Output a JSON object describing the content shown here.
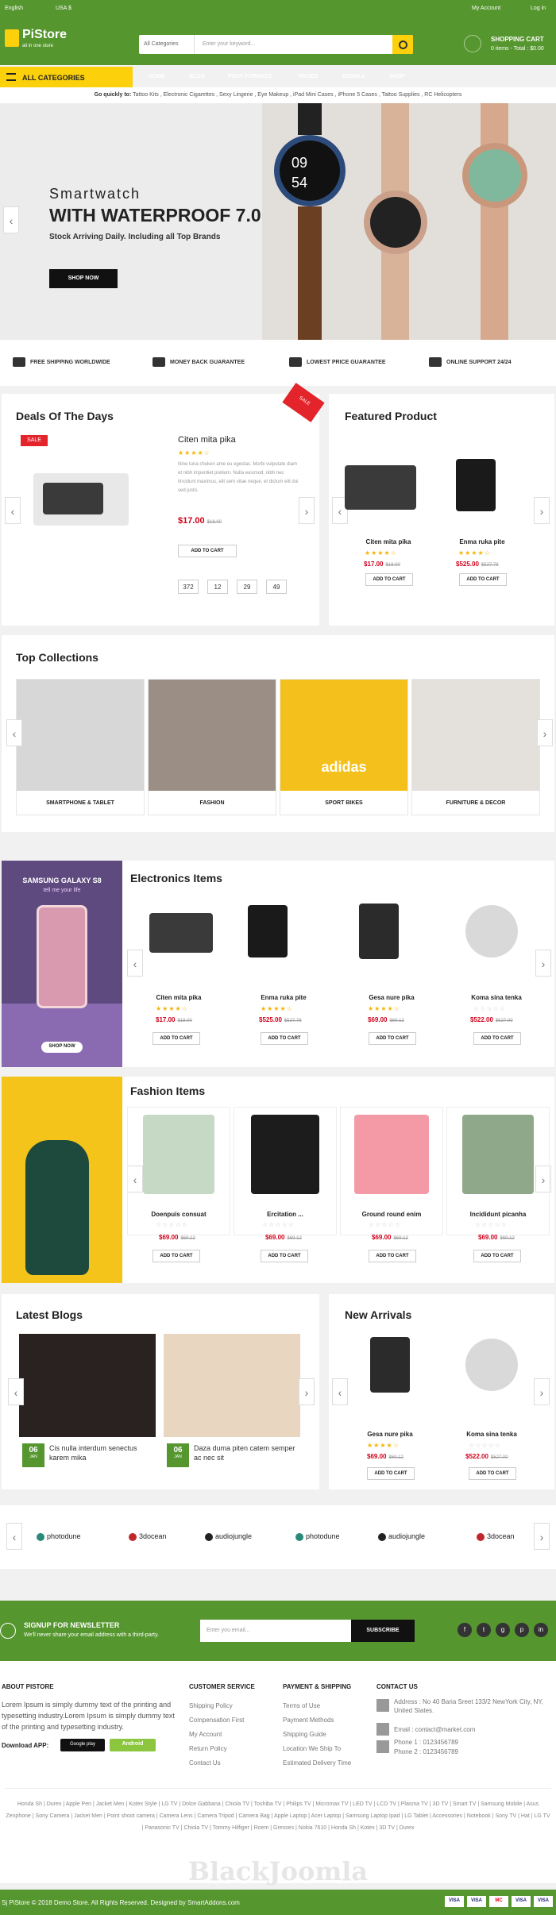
{
  "topbar": {
    "language": "English",
    "currency": "USA $",
    "account": "My Account",
    "login": "Log in"
  },
  "header": {
    "logo": "PiStore",
    "tagline": "all in one store",
    "search_category": "All Categories",
    "search_placeholder": "Enter your keyword...",
    "cart_title": "SHOPPING CART",
    "cart_summary": "0 items - Total : $0.00"
  },
  "nav": {
    "all_categories": "ALL CATEGORIES",
    "items": [
      "HOME",
      "BLOG",
      "POST FORMATS",
      "PAGES",
      "JOOMLA",
      "SHOP"
    ]
  },
  "quick": {
    "label": "Go quickly to:",
    "links": "Tattoo Kits , Electronic Cigarettes , Sexy Lingerie , Eye Makeup , iPad Mini Cases , iPhone 5 Cases , Tattoo Supplies , RC Helicopters"
  },
  "hero": {
    "line1": "Smartwatch",
    "line2": "WITH WATERPROOF 7.0",
    "line3": "Stock Arriving Daily. Including all Top Brands",
    "button": "SHOP NOW",
    "watch_time_h": "09",
    "watch_time_m": "54"
  },
  "services": [
    "FREE SHIPPING WORLDWIDE",
    "MONEY BACK GUARANTEE",
    "LOWEST PRICE GUARANTEE",
    "ONLINE SUPPORT 24/24"
  ],
  "deals": {
    "title": "Deals Of The Days",
    "sale_badge": "SALE",
    "name": "Citen mita pika",
    "stars": "★★★★☆",
    "desc": "Nine tuna chuken ame eu egestas. Morbi vulputate diam et nibh imperdiet pretium. Nulla euismod, nibh nec tincidunt maximus, elit sem vitae neque, et dictum elit dui sed justo.",
    "price": "$17.00",
    "old_price": "$18.00",
    "button": "ADD TO CART",
    "countdown": [
      "372",
      "12",
      "29",
      "49"
    ],
    "ribbon": "SALE"
  },
  "featured": {
    "title": "Featured Product",
    "items": [
      {
        "name": "Citen mita pika",
        "stars": "★★★★☆",
        "price": "$17.00",
        "old": "$18.00",
        "button": "ADD TO CART"
      },
      {
        "name": "Enma ruka pite",
        "stars": "★★★★☆",
        "price": "$525.00",
        "old": "$527.78",
        "button": "ADD TO CART"
      }
    ]
  },
  "collections": {
    "title": "Top Collections",
    "items": [
      "SMARTPHONE & TABLET",
      "FASHION",
      "SPORT BIKES",
      "FURNITURE & DECOR"
    ],
    "jacket_text": "adidas"
  },
  "electronics": {
    "title": "Electronics Items",
    "banner_line1": "SAMSUNG GALAXY S8",
    "banner_line2": "tell me your life",
    "banner_button": "SHOP NOW",
    "items": [
      {
        "name": "Citen mita pika",
        "stars": "★★★★☆",
        "price": "$17.00",
        "old": "$18.00",
        "button": "ADD TO CART"
      },
      {
        "name": "Enma ruka pite",
        "stars": "★★★★☆",
        "price": "$525.00",
        "old": "$527.78",
        "button": "ADD TO CART"
      },
      {
        "name": "Gesa nure pika",
        "stars": "★★★★☆",
        "price": "$69.00",
        "old": "$69.12",
        "button": "ADD TO CART"
      },
      {
        "name": "Koma sina tenka",
        "stars": "☆☆☆☆☆",
        "price": "$522.00",
        "old": "$527.00",
        "button": "ADD TO CART"
      }
    ]
  },
  "fashion": {
    "title": "Fashion Items",
    "items": [
      {
        "name": "Doenpuis consuat",
        "stars": "☆☆☆☆☆",
        "price": "$69.00",
        "old": "$69.12",
        "button": "ADD TO CART"
      },
      {
        "name": "Ercitation ...",
        "stars": "☆☆☆☆☆",
        "price": "$69.00",
        "old": "$69.12",
        "button": "ADD TO CART"
      },
      {
        "name": "Ground round enim",
        "stars": "☆☆☆☆☆",
        "price": "$69.00",
        "old": "$69.12",
        "button": "ADD TO CART"
      },
      {
        "name": "Incididunt picanha",
        "stars": "☆☆☆☆☆",
        "price": "$69.00",
        "old": "$69.12",
        "button": "ADD TO CART"
      }
    ]
  },
  "blogs": {
    "title": "Latest Blogs",
    "items": [
      {
        "day": "06",
        "month": "JAN",
        "title": "Cis nulla interdum senectus karem mika"
      },
      {
        "day": "06",
        "month": "JAN",
        "title": "Daza duma piten catem semper ac nec sit"
      }
    ]
  },
  "arrivals": {
    "title": "New Arrivals",
    "items": [
      {
        "name": "Gesa nure pika",
        "stars": "★★★★☆",
        "price": "$69.00",
        "old": "$69.12",
        "button": "ADD TO CART"
      },
      {
        "name": "Koma sina tenka",
        "stars": "☆☆☆☆☆",
        "price": "$522.00",
        "old": "$527.00",
        "button": "ADD TO CART"
      }
    ]
  },
  "brands": [
    "photodune",
    "3docean",
    "audiojungle",
    "photodune",
    "audiojungle",
    "3docean"
  ],
  "newsletter": {
    "title": "SIGNUP FOR NEWSLETTER",
    "text": "We'll never share your email address with a third-party.",
    "placeholder": "Enter you email...",
    "button": "SUBSCRIBE"
  },
  "footer": {
    "about_title": "ABOUT PISTORE",
    "about_text": "Lorem Ipsum is simply dummy text of the printing and typesetting industry.Lorem Ipsum is simply dummy text of the printing and typesetting industry.",
    "download": "Download APP:",
    "google_play": "Google play",
    "android": "Android",
    "customer_title": "CUSTOMER SERVICE",
    "customer_links": [
      "Shipping Policy",
      "Compensation First",
      "My Account",
      "Return Policy",
      "Contact Us"
    ],
    "payment_title": "PAYMENT & SHIPPING",
    "payment_links": [
      "Terms of Use",
      "Payment Methods",
      "Shipping Guide",
      "Location We Ship To",
      "Estimated Delivery Time"
    ],
    "contact_title": "CONTACT US",
    "address": "Address : No 40 Baria Sreet 133/2 NewYork City, NY, United States.",
    "email": "Email : contact@market.com",
    "phone1": "Phone 1 : 0123456789",
    "phone2": "Phone 2 : 0123456789"
  },
  "tags": "Honda Sh | Durex | Apple Pen | Jacket Men | Kotex Style | LG TV | Dolce Gabbana | Chiola TV | Toshiba TV | Philips TV | Micromax TV | LED TV | LCD TV | Plasma TV | 3D TV | Smart TV | Samsung Mobile | Asus Zenphone | Sony Camera | Jacket Men | Point shoot camera | Camera Lens | Camera Tripod | Camera Bag | Apple Laptop | Acer Laptop | Samsung Laptop Ipad | LG Tablet | Accessories | Notebook | Sony TV | Hat | LG TV | Panasonic TV | Chiola TV | Tommy Hilfiger | Roem | Gresses | Nokia 7610 | Honda Sh | Kotex | 3D TV | Durex",
  "watermark": "BlackJoomla",
  "copyright": "Sj PiStore © 2018 Demo Store. All Rights Reserved. Designed by SmartAddons.com",
  "payment_cards": [
    "VISA",
    "VISA",
    "MC",
    "VISA",
    "VISA"
  ]
}
